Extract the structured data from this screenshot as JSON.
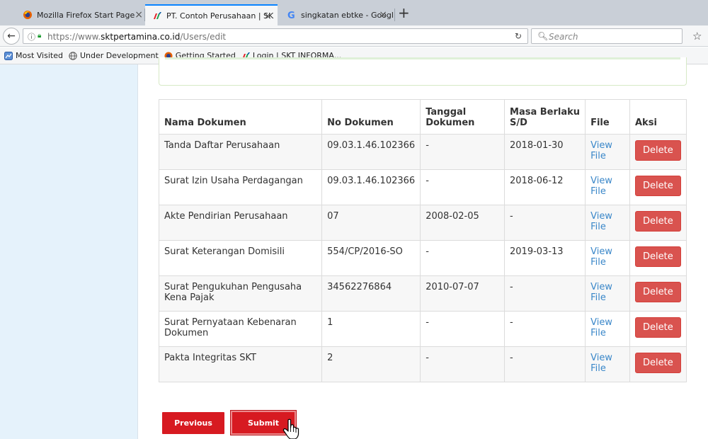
{
  "browser": {
    "tabs": [
      {
        "title": "Mozilla Firefox Start Page",
        "active": false
      },
      {
        "title": "PT. Contoh Perusahaan | SK",
        "active": true
      },
      {
        "title": "singkatan ebtke - Google Se",
        "active": false
      }
    ],
    "new_tab": "+",
    "close_glyph": "×",
    "url_prefix": "https://www.",
    "url_domain": "sktpertamina.co.id",
    "url_path": "/Users/edit",
    "search_placeholder": "Search",
    "bookmarks": [
      {
        "label": "Most Visited",
        "icon": "most-visited-icon"
      },
      {
        "label": "Under Development",
        "icon": "globe-icon"
      },
      {
        "label": "Getting Started",
        "icon": "firefox-icon"
      },
      {
        "label": "Login | SKT INFORMA...",
        "icon": "pertamina-icon"
      }
    ]
  },
  "table": {
    "headers": [
      "Nama Dokumen",
      "No Dokumen",
      "Tanggal Dokumen",
      "Masa Berlaku S/D",
      "File",
      "Aksi"
    ],
    "rows": [
      {
        "nama": "Tanda Daftar Perusahaan",
        "no": "09.03.1.46.102366",
        "tanggal": "-",
        "masa": "2018-01-30",
        "file": "View File",
        "aksi": "Delete"
      },
      {
        "nama": "Surat Izin Usaha Perdagangan",
        "no": "09.03.1.46.102366",
        "tanggal": "-",
        "masa": "2018-06-12",
        "file": "View File",
        "aksi": "Delete"
      },
      {
        "nama": "Akte Pendirian Perusahaan",
        "no": "07",
        "tanggal": "2008-02-05",
        "masa": "-",
        "file": "View File",
        "aksi": "Delete"
      },
      {
        "nama": "Surat Keterangan Domisili",
        "no": "554/CP/2016-SO",
        "tanggal": "-",
        "masa": "2019-03-13",
        "file": "View File",
        "aksi": "Delete"
      },
      {
        "nama": "Surat Pengukuhan Pengusaha Kena Pajak",
        "no": "34562276864",
        "tanggal": "2010-07-07",
        "masa": "-",
        "file": "View File",
        "aksi": "Delete"
      },
      {
        "nama": "Surat Pernyataan Kebenaran Dokumen",
        "no": "1",
        "tanggal": "-",
        "masa": "-",
        "file": "View File",
        "aksi": "Delete"
      },
      {
        "nama": "Pakta Integritas SKT",
        "no": "2",
        "tanggal": "-",
        "masa": "-",
        "file": "View File",
        "aksi": "Delete"
      }
    ]
  },
  "form": {
    "previous_label": "Previous",
    "submit_label": "Submit"
  },
  "colors": {
    "primary_red": "#d71a21",
    "delete_red": "#d9534f",
    "link_blue": "#3a87c9",
    "sidebar_bg": "#e5f2fb"
  }
}
